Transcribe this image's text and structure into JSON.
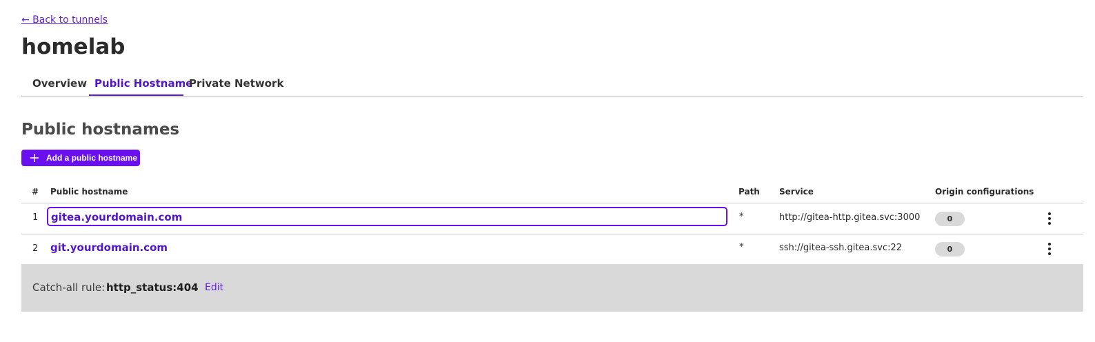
{
  "nav": {
    "back_label": "← Back to tunnels"
  },
  "tunnel": {
    "name": "homelab"
  },
  "tabs": [
    {
      "label": "Overview",
      "active": false
    },
    {
      "label": "Public Hostname",
      "active": true
    },
    {
      "label": "Private Network",
      "active": false
    }
  ],
  "section": {
    "title": "Public hostnames",
    "add_button_label": "Add a public hostname",
    "add_button_icon": "plus-icon"
  },
  "table": {
    "headers": [
      "#",
      "Public hostname",
      "Path",
      "Service",
      "Origin configurations"
    ],
    "rows": [
      {
        "index": "1",
        "hostname": "gitea.yourdomain.com",
        "path": "*",
        "service": "http://gitea-http.gitea.svc:3000",
        "origin_configurations": "0"
      },
      {
        "index": "2",
        "hostname": "git.yourdomain.com",
        "path": "*",
        "service": "ssh://gitea-ssh.gitea.svc:22",
        "origin_configurations": "0"
      }
    ]
  },
  "catch_all": {
    "label": "Catch-all rule:",
    "value": "http_status:404",
    "edit_label": "Edit"
  },
  "colors": {
    "accent": "#6a10f0",
    "link": "#5217c6",
    "catch_all_bg": "#d9d9d9"
  }
}
